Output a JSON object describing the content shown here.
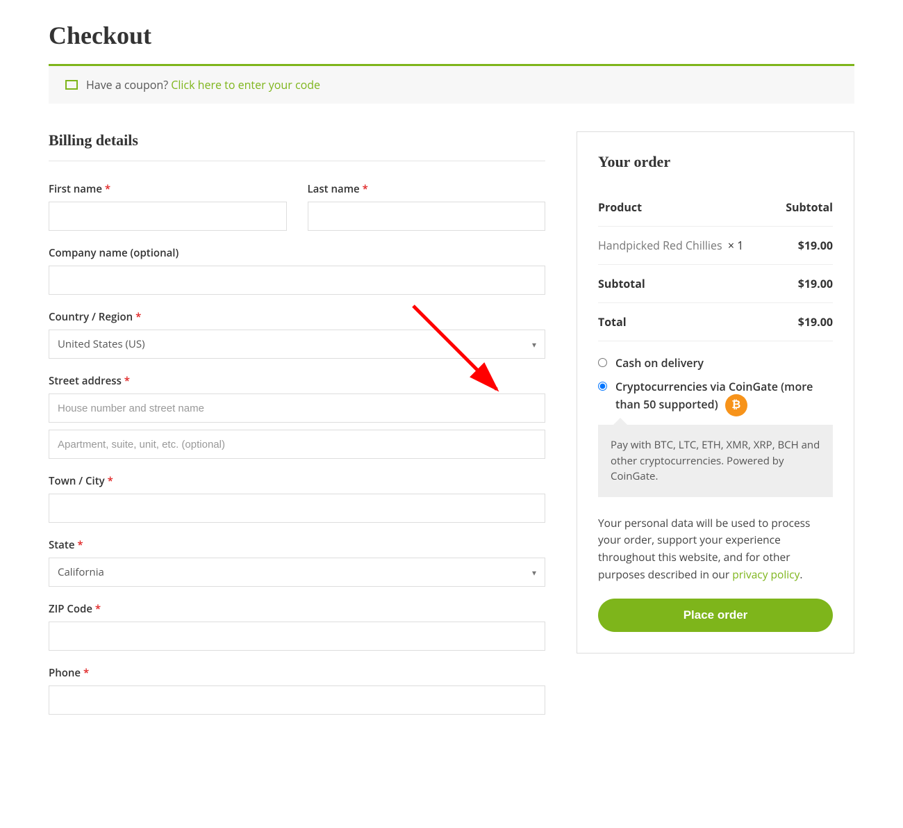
{
  "page": {
    "title": "Checkout"
  },
  "coupon": {
    "prompt": "Have a coupon? ",
    "link": "Click here to enter your code"
  },
  "billing": {
    "heading": "Billing details",
    "first_name_label": "First name ",
    "last_name_label": "Last name ",
    "company_label": "Company name (optional)",
    "country_label": "Country / Region ",
    "country_value": "United States (US)",
    "street_label": "Street address ",
    "street_placeholder": "House number and street name",
    "street2_placeholder": "Apartment, suite, unit, etc. (optional)",
    "city_label": "Town / City ",
    "state_label": "State ",
    "state_value": "California",
    "zip_label": "ZIP Code ",
    "phone_label": "Phone "
  },
  "order": {
    "heading": "Your order",
    "col_product": "Product",
    "col_subtotal": "Subtotal",
    "items": [
      {
        "name": "Handpicked Red Chillies",
        "qty": "× 1",
        "price": "$19.00"
      }
    ],
    "subtotal_label": "Subtotal",
    "subtotal_value": "$19.00",
    "total_label": "Total",
    "total_value": "$19.00"
  },
  "payment": {
    "cod_label": "Cash on delivery",
    "crypto_label": "Cryptocurrencies via CoinGate (more than 50 supported)",
    "crypto_desc": "Pay with BTC, LTC, ETH, XMR, XRP, BCH and other cryptocurrencies. Powered by CoinGate."
  },
  "privacy": {
    "text": "Your personal data will be used to process your order, support your experience throughout this website, and for other purposes described in our ",
    "link": "privacy policy",
    "after": "."
  },
  "buttons": {
    "place_order": "Place order"
  }
}
